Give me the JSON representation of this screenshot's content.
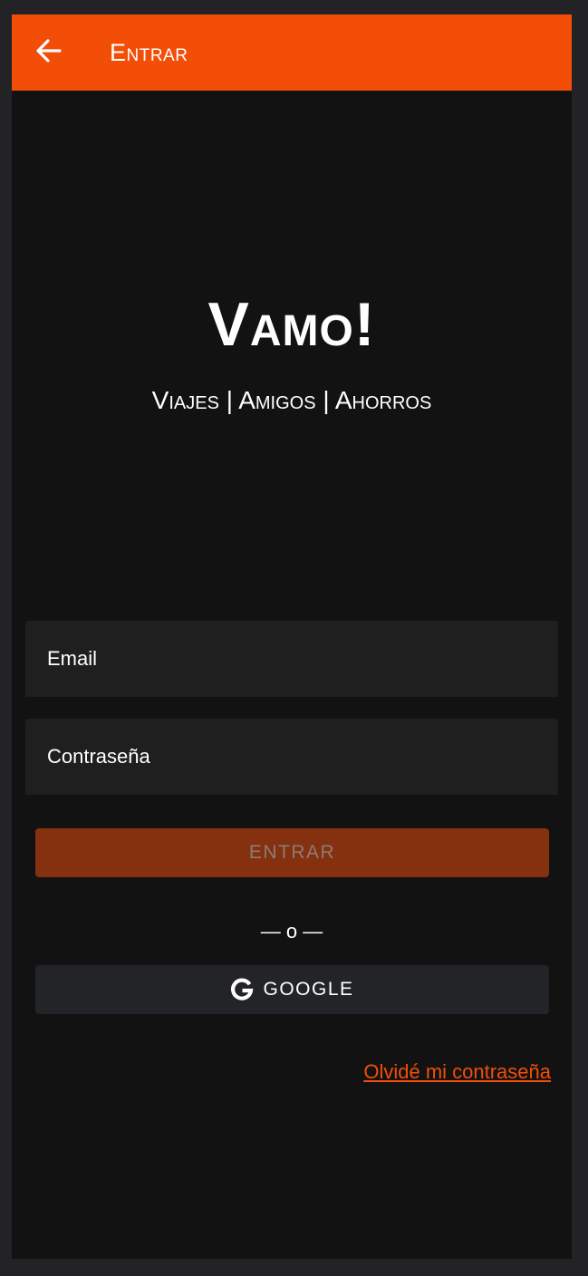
{
  "appbar": {
    "title": "Entrar",
    "back_icon": "arrow-left-icon",
    "color": "#f24e07"
  },
  "hero": {
    "title": "Vamo!",
    "subtitle": "Viajes | Amigos | Ahorros"
  },
  "form": {
    "email_placeholder": "Email",
    "email_value": "",
    "password_placeholder": "Contraseña",
    "password_value": "",
    "submit_label": "ENTRAR",
    "divider_text": "— o —",
    "google_label": "GOOGLE",
    "google_icon": "google-g-icon",
    "forgot_label": "Olvidé mi contraseña"
  },
  "colors": {
    "accent": "#f24e07",
    "background": "#121212",
    "field_background": "#1f1f1f",
    "submit_disabled": "#85300f",
    "google_button": "#232428"
  }
}
